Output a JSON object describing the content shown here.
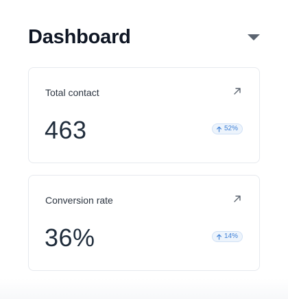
{
  "header": {
    "title": "Dashboard",
    "dropdown_icon": "caret-down-icon"
  },
  "cards": [
    {
      "title": "Total contact",
      "value": "463",
      "change": "52%",
      "change_direction": "up",
      "link_icon": "arrow-up-right-icon"
    },
    {
      "title": "Conversion rate",
      "value": "36%",
      "change": "14%",
      "change_direction": "up",
      "link_icon": "arrow-up-right-icon"
    }
  ],
  "colors": {
    "text_primary": "#0f1624",
    "badge_text": "#3d7fd6",
    "badge_bg": "#edf4fc",
    "card_border": "#e6e9ee"
  }
}
